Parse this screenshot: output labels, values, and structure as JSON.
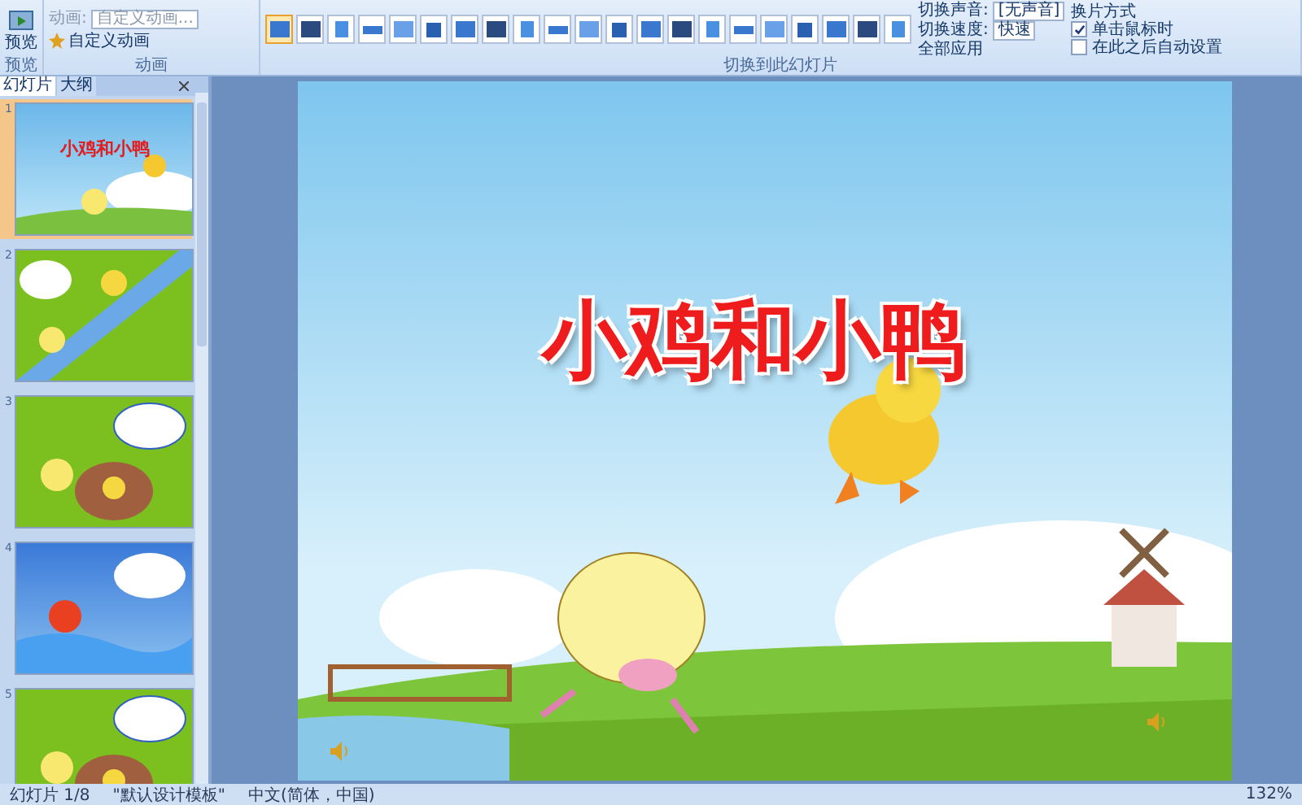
{
  "ribbon": {
    "preview": {
      "button": "预览",
      "group_label": "预览"
    },
    "animation": {
      "field_label": "动画:",
      "field_value": "自定义动画...",
      "button": "自定义动画",
      "group_label": "动画"
    },
    "transitions": {
      "group_label": "切换到此幻灯片",
      "gallery": [
        {
          "selected": true
        },
        {
          "selected": false
        },
        {
          "selected": false
        },
        {
          "selected": false
        },
        {
          "selected": false
        },
        {
          "selected": false
        },
        {
          "selected": false
        },
        {
          "selected": false
        },
        {
          "selected": false
        },
        {
          "selected": false
        },
        {
          "selected": false
        },
        {
          "selected": false
        },
        {
          "selected": false
        },
        {
          "selected": false
        },
        {
          "selected": false
        },
        {
          "selected": false
        },
        {
          "selected": false
        },
        {
          "selected": false
        },
        {
          "selected": false
        },
        {
          "selected": false
        },
        {
          "selected": false
        }
      ]
    },
    "sound": {
      "label": "切换声音:",
      "value": "[无声音]"
    },
    "speed": {
      "label": "切换速度:",
      "value": "快速"
    },
    "apply_all": "全部应用",
    "advance": {
      "title": "换片方式",
      "options": [
        {
          "label": "单击鼠标时",
          "checked": true
        },
        {
          "label": "在此之后自动设置",
          "checked": false
        }
      ]
    }
  },
  "pane": {
    "tabs": [
      {
        "label": "幻灯片",
        "selected": true
      },
      {
        "label": "大纲",
        "selected": false
      }
    ],
    "slides": [
      {
        "number": "1",
        "selected": true,
        "kind": "title",
        "title": "小鸡和小鸭"
      },
      {
        "number": "2",
        "selected": false,
        "kind": "river"
      },
      {
        "number": "3",
        "selected": false,
        "kind": "bubble"
      },
      {
        "number": "4",
        "selected": false,
        "kind": "water"
      },
      {
        "number": "5",
        "selected": false,
        "kind": "bubble"
      }
    ]
  },
  "slide": {
    "title": "小鸡和小鸭"
  },
  "status_bar": {
    "slide": "幻灯片 1/8",
    "theme": "\"默认设计模板\"",
    "language": "中文(简体，中国)",
    "zoom": "132%"
  }
}
